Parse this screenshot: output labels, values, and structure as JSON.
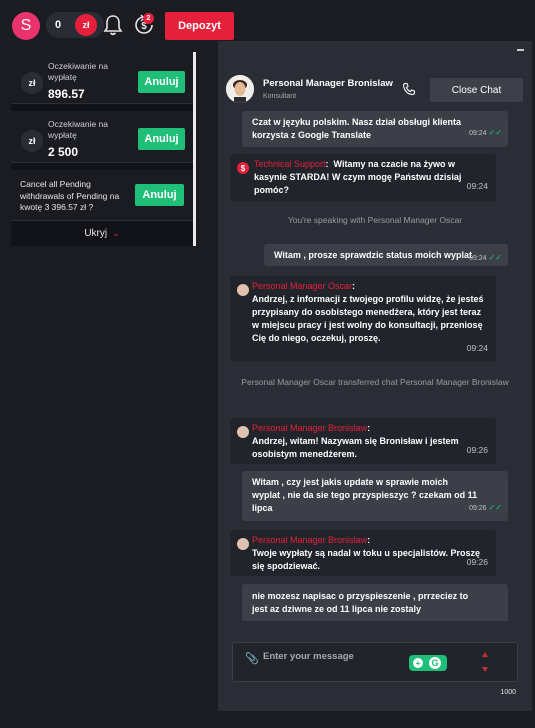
{
  "topbar": {
    "avatar_letter": "S",
    "balance": "0",
    "currency": "zł",
    "withdrawals_badge": "2",
    "deposit_label": "Depozyt"
  },
  "withdrawals": {
    "items": [
      {
        "coin": "zł",
        "label": "Oczekiwanie na wypłatę",
        "amount": "896.57",
        "button": "Anuluj"
      },
      {
        "coin": "zł",
        "label": "Oczekiwanie na wypłatę",
        "amount": "2 500",
        "button": "Anuluj"
      }
    ],
    "cancel_all_label": "Cancel all Pending withdrawals of Pending na kwotę 3 396.57 zł ?",
    "cancel_all_button": "Anuluj",
    "hide_label": "Ukryj"
  },
  "chat": {
    "agent_name": "Personal Manager Bronislaw",
    "agent_role": "Konsultant",
    "close_label": "Close Chat",
    "input_placeholder": "Enter your message",
    "char_counter": "1000",
    "messages": [
      {
        "type": "user",
        "text": "Czat w języku polskim. Nasz dział obsługi klienta korzysta z Google Translate",
        "time": "09:24"
      },
      {
        "type": "agent",
        "sender": "Technical Support",
        "text": "Witamy na czacie na żywo w kasynie STARDA! W czym mogę Państwu dzisiaj pomóc?",
        "time": "09:24"
      },
      {
        "type": "system",
        "text": "You're speaking with Personal Manager Oscar"
      },
      {
        "type": "user",
        "text": "Witam , prosze sprawdzic status moich wyplat",
        "time": "09:24"
      },
      {
        "type": "agent",
        "sender": "Personal Manager Oscar",
        "text": "Andrzej, z informacji z twojego profilu widzę, że jesteś przypisany do osobistego menedżera, który jest teraz w miejscu pracy i jest wolny do konsultacji, przeniosę Cię do niego, oczekuj, proszę.",
        "time": "09:24"
      },
      {
        "type": "system",
        "text": "Personal Manager Oscar transferred chat Personal Manager Bronislaw"
      },
      {
        "type": "agent",
        "sender": "Personal Manager Bronislaw",
        "text": "Andrzej, witam! Nazywam się Bronisław i jestem osobistym menedżerem.",
        "time": "09:26"
      },
      {
        "type": "user",
        "text": "Witam , czy jest jakis update w sprawie moich wyplat , nie da sie tego przyspieszyc ? czekam od 11 lipca",
        "time": "09:26"
      },
      {
        "type": "agent",
        "sender": "Personal Manager Bronislaw",
        "text": "Twoje wypłaty są nadal w toku u specjalistów. Proszę się spodziewać.",
        "time": "09:26"
      },
      {
        "type": "user",
        "text": "nie mozesz napisac o przyspieszenie , prrzeciez to jest az dziwne ze od 11 lipca nie zostaly",
        "time": ""
      }
    ]
  },
  "colors": {
    "accent_red": "#e5203b",
    "accent_green": "#1fbf79",
    "panel": "#2b2d36",
    "background": "#1b1c22"
  }
}
